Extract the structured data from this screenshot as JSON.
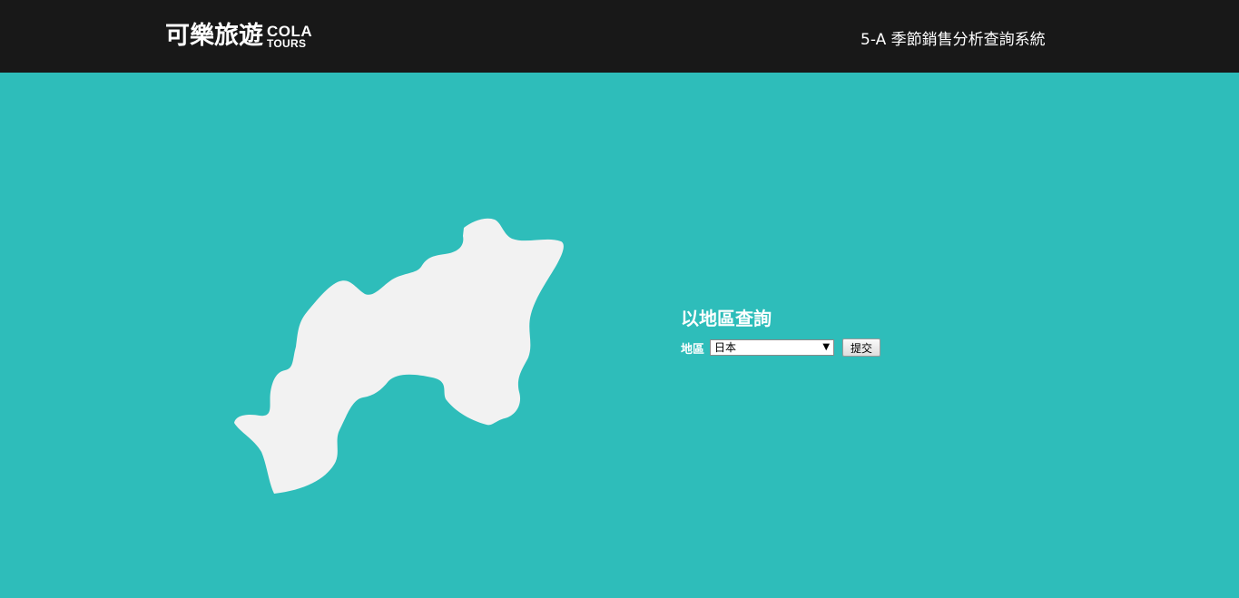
{
  "header": {
    "logo_text_cn": "可樂旅遊",
    "logo_text_en_top": "COLA",
    "logo_text_en_bottom": "TOURS",
    "system_title": "5-A 季節銷售分析查詢系統"
  },
  "query": {
    "heading": "以地區查詢",
    "region_label": "地區",
    "region_selected": "日本",
    "submit_label": "提交"
  },
  "colors": {
    "background": "#2ebdba",
    "header_bg": "#181818",
    "map_fill": "#f2f2f2"
  }
}
